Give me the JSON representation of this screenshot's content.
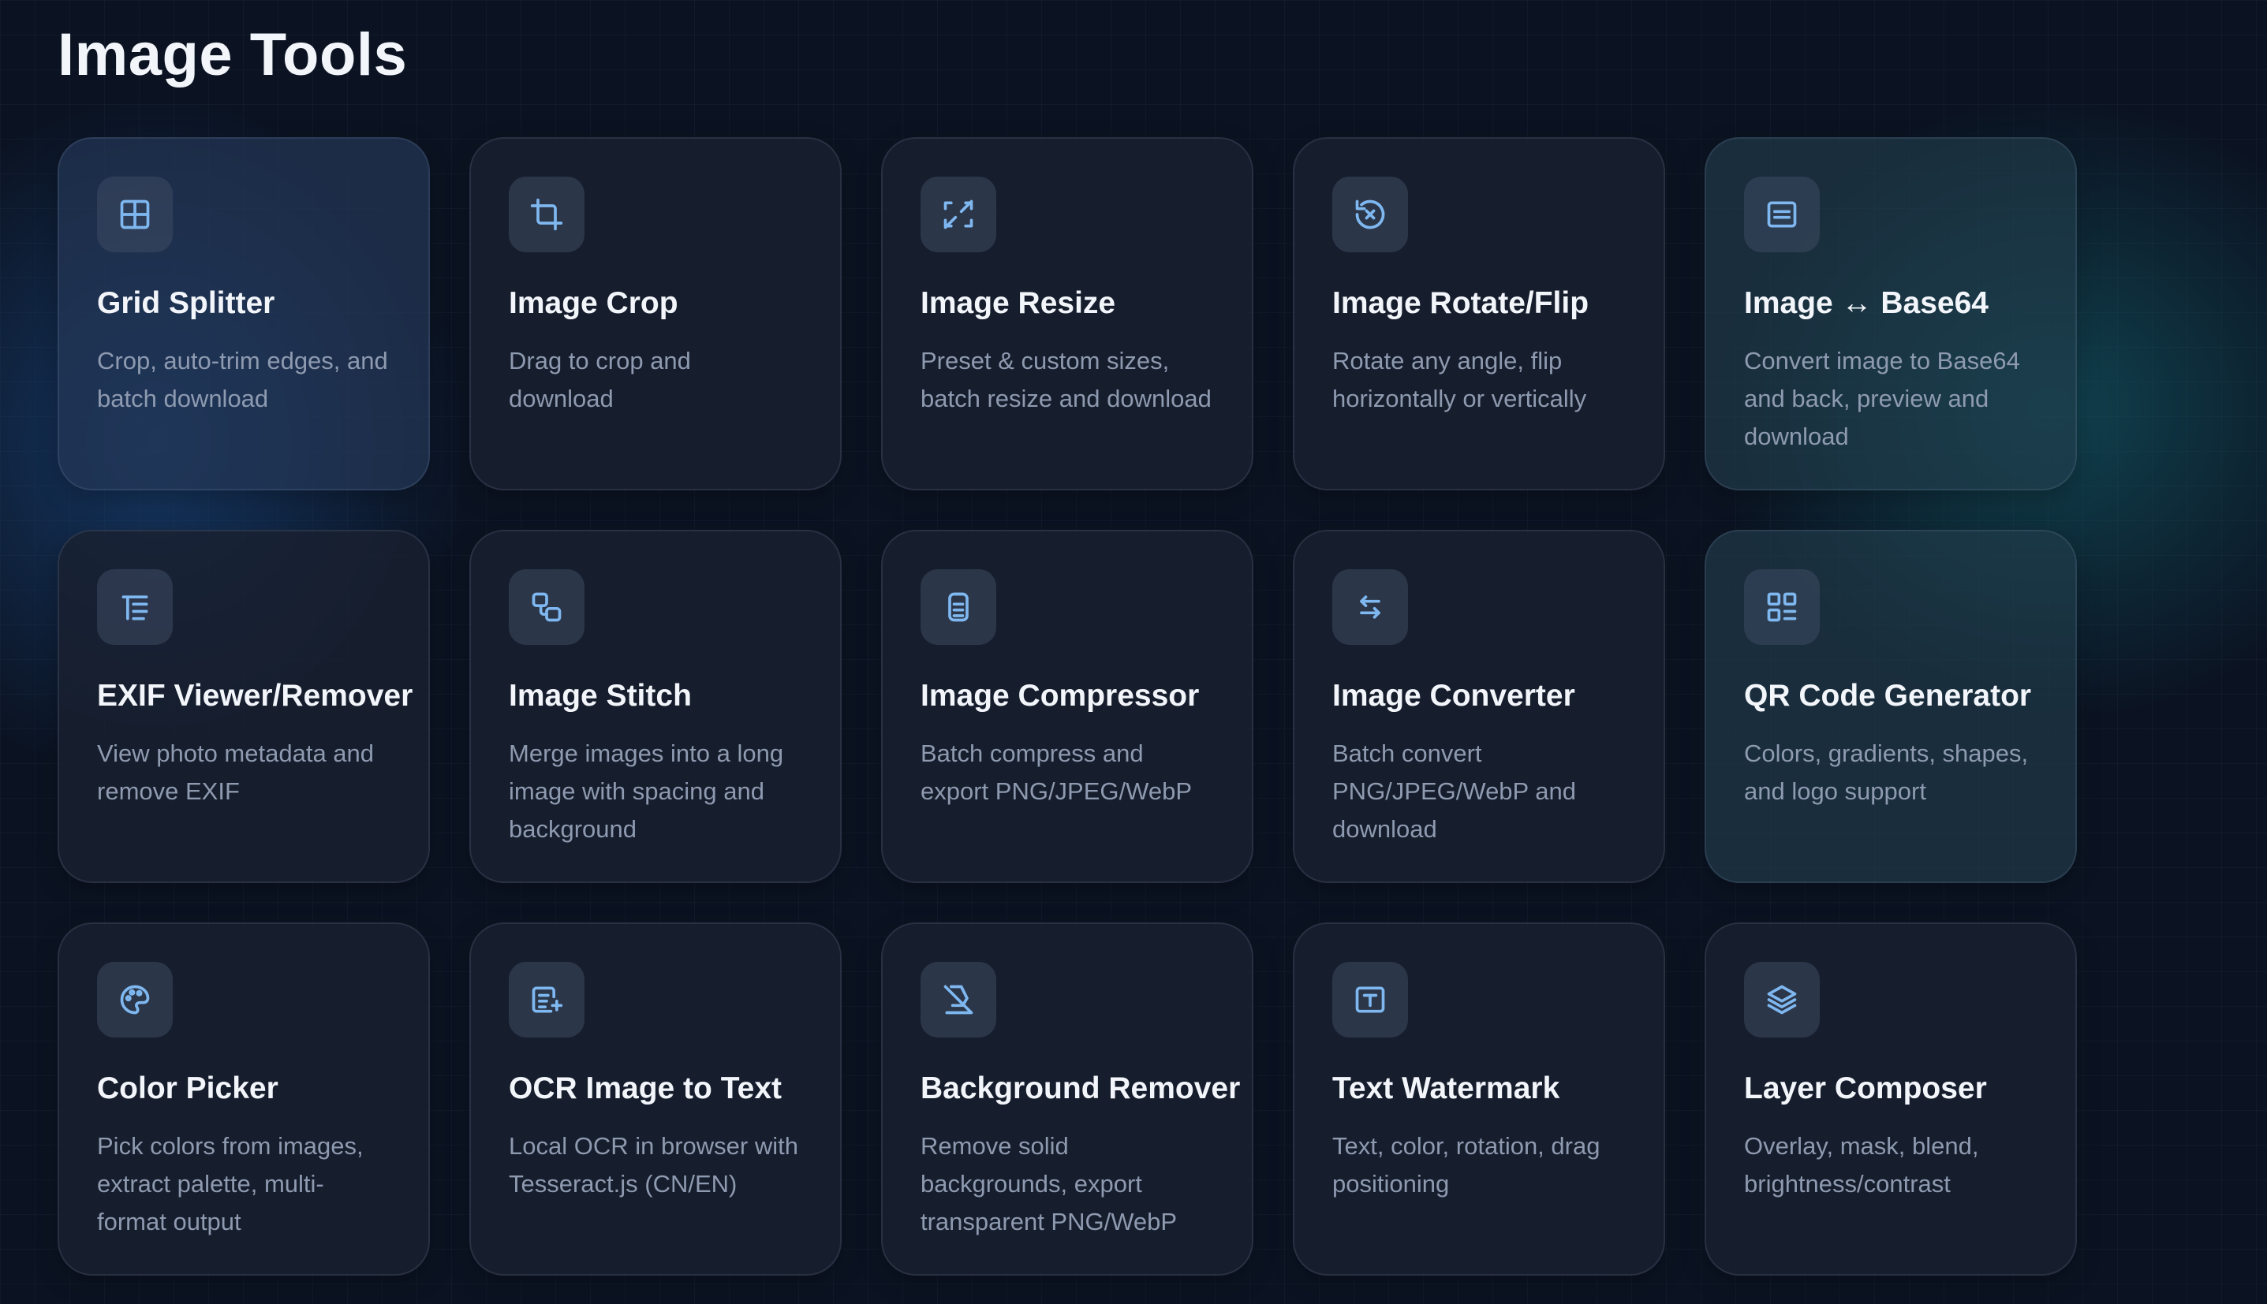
{
  "page": {
    "title": "Image Tools"
  },
  "tools": [
    {
      "title": "Grid Splitter",
      "description": "Crop, auto-trim edges, and batch download",
      "icon": "grid-icon"
    },
    {
      "title": "Image Crop",
      "description": "Drag to crop and download",
      "icon": "crop-icon"
    },
    {
      "title": "Image Resize",
      "description": "Preset & custom sizes, batch resize and download",
      "icon": "resize-icon"
    },
    {
      "title": "Image Rotate/Flip",
      "description": "Rotate any angle, flip horizontally or vertically",
      "icon": "rotate-icon"
    },
    {
      "title": "Image ↔ Base64",
      "description": "Convert image to Base64 and back, preview and download",
      "icon": "base64-icon"
    },
    {
      "title": "EXIF Viewer/Remover",
      "description": "View photo metadata and remove EXIF",
      "icon": "list-icon"
    },
    {
      "title": "Image Stitch",
      "description": "Merge images into a long image with spacing and background",
      "icon": "stitch-icon"
    },
    {
      "title": "Image Compressor",
      "description": "Batch compress and export PNG/JPEG/WebP",
      "icon": "compress-icon"
    },
    {
      "title": "Image Converter",
      "description": "Batch convert PNG/JPEG/WebP and download",
      "icon": "convert-icon"
    },
    {
      "title": "QR Code Generator",
      "description": "Colors, gradients, shapes, and logo support",
      "icon": "qr-icon"
    },
    {
      "title": "Color Picker",
      "description": "Pick colors from images, extract palette, multi-format output",
      "icon": "palette-icon"
    },
    {
      "title": "OCR Image to Text",
      "description": "Local OCR in browser with Tesseract.js (CN/EN)",
      "icon": "ocr-icon"
    },
    {
      "title": "Background Remover",
      "description": "Remove solid backgrounds, export transparent PNG/WebP",
      "icon": "eraser-icon"
    },
    {
      "title": "Text Watermark",
      "description": "Text, color, rotation, drag positioning",
      "icon": "text-icon"
    },
    {
      "title": "Layer Composer",
      "description": "Overlay, mask, blend, brightness/contrast",
      "icon": "layers-icon"
    }
  ],
  "colors": {
    "background": "#0b1322",
    "card": "#1a2030",
    "icon_accent": "#7fb8f0",
    "title_text": "#f2f5fa",
    "desc_text": "#8e9ab0"
  }
}
